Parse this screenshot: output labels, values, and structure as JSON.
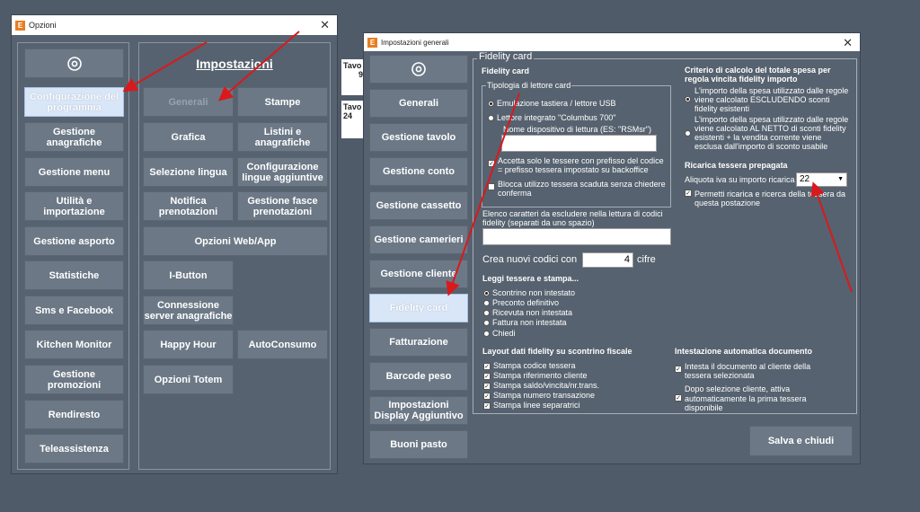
{
  "opzioni": {
    "title": "Opzioni",
    "close": "✕",
    "power_icon": "power-icon",
    "left_buttons": [
      "Configurazione del programma",
      "Gestione anagrafiche",
      "Gestione menu",
      "Utilità e importazione",
      "Gestione asporto",
      "Statistiche",
      "Sms e Facebook",
      "Kitchen Monitor",
      "Gestione promozioni",
      "Rendiresto",
      "Teleassistenza"
    ],
    "impostazioni_title": "Impostazioni",
    "right_buttons": [
      "Generali",
      "Stampe",
      "Grafica",
      "Listini e anagrafiche",
      "Selezione lingua",
      "Configurazione lingue aggiuntive",
      "Notifica prenotazioni",
      "Gestione fasce prenotazioni",
      "Opzioni Web/App",
      "I-Button",
      "Connessione server anagrafiche",
      "Happy Hour",
      "AutoConsumo",
      "Opzioni Totem"
    ]
  },
  "background_fragments": [
    "Tavo",
    "9",
    "Tavo",
    "24"
  ],
  "generali": {
    "title": "Impostazioni generali",
    "close": "✕",
    "nav": [
      "Generali",
      "Gestione tavolo",
      "Gestione conto",
      "Gestione cassetto",
      "Gestione camerieri",
      "Gestione cliente",
      "Fidelity card",
      "Fatturazione",
      "Barcode peso",
      "Impostazioni Display Aggiuntivo",
      "Buoni pasto"
    ],
    "group_title": "Fidelity card",
    "fidelity_heading": "Fidelity card",
    "tipologia_legend": "Tipologia di lettore card",
    "radio_emulazione": "Emulazione tastiera / lettore USB",
    "radio_integrato": "Lettore integrato \"Columbus 700\"",
    "nome_dispositivo": "Nome dispositivo di lettura (ES: \"RSMsr\")",
    "chk_accetta": "Accetta solo le tessere con prefisso del codice = prefisso tessera impostato su backoffice",
    "chk_blocca": "Blocca utilizzo tessera scaduta senza chiedere conferma",
    "elenco_caratteri": "Elenco caratteri da escludere nella lettura di codici fidelity (separati da uno spazio)",
    "crea_nuovi": "Crea nuovi codici con",
    "cifre_value": "4",
    "cifre": "cifre",
    "leggi_heading": "Leggi tessera e stampa...",
    "leggi_options": [
      "Scontrino non intestato",
      "Preconto definitivo",
      "Ricevuta non intestata",
      "Fattura non intestata",
      "Chiedi"
    ],
    "layout_heading": "Layout dati fidelity su scontrino fiscale",
    "layout_options": [
      "Stampa codice tessera",
      "Stampa riferimento cliente",
      "Stampa saldo/vincita/nr.trans.",
      "Stampa numero transazione",
      "Stampa linee separatrici"
    ],
    "criterio_heading": "Criterio di calcolo del totale spesa per regola vincita fidelity importo",
    "criterio_escludendo": "L'importo della spesa utilizzato dalle regole viene calcolato ESCLUDENDO sconti fidelity esistenti",
    "criterio_netto": "L'importo della spesa utilizzato dalle regole viene calcolato AL NETTO di sconti fidelity esistenti + la vendita corrente viene esclusa dall'importo di sconto usabile",
    "ricarica_heading": "Ricarica tessera prepagata",
    "aliquota_label": "Aliquota iva su importo ricarica",
    "aliquota_value": "22",
    "chk_permetti": "Permetti ricarica e ricerca della tessera da questa postazione",
    "intestazione_heading": "Intestazione automatica documento",
    "chk_intesta": "Intesta il documento al cliente della tessera selezionata",
    "dopo_selezione": "Dopo selezione cliente, attiva",
    "chk_automatic": "automaticamente la prima tessera disponibile",
    "salva": "Salva e chiudi"
  },
  "colors": {
    "window_bg": "#56626f",
    "button_bg": "#6c7886",
    "active_bg": "#d9e6f7",
    "arrow": "#d9191c"
  }
}
